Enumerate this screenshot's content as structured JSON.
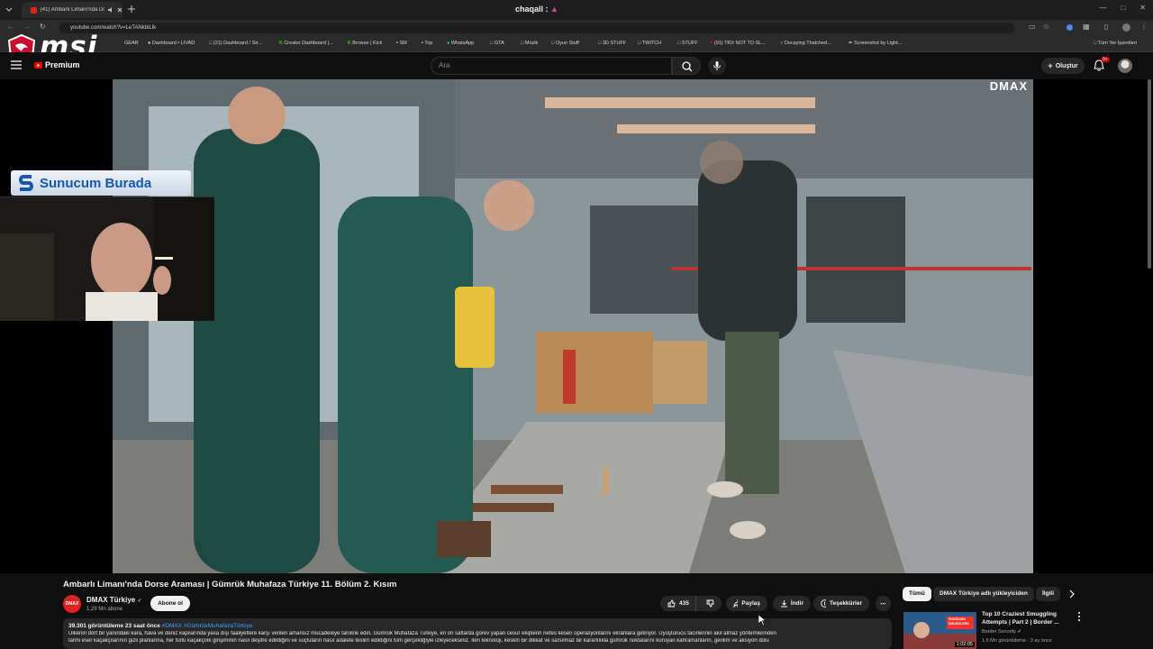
{
  "browser": {
    "tab_title": "(41) Ambarlı Limanı'nda Dorse",
    "center_title": "chaqall :",
    "url": "youtube.com/watch?v=LeTANkbiLlk",
    "bookmarks": [
      "GEAR",
      "Dashboard • LIVAD",
      "(21) Dashboard / Str...",
      "Creator Dashboard |...",
      "Browse | Kick",
      "SM",
      "Top",
      "WhatsApp",
      "GTA",
      "Müzik",
      "Oyun Stuff",
      "3D STUFF",
      "TWITCH",
      "STUFF",
      "(91) TRX NOT TO SL...",
      "Decaying Thatched...",
      "Screenshot by Light...",
      "Tüm Yer İşaretleri"
    ]
  },
  "overlay": {
    "logo_text": "msi",
    "sunucum_label": "Sunucum Burada"
  },
  "youtube": {
    "premium_label": "Premium",
    "search_placeholder": "Ara",
    "create_label": "Oluştur",
    "notif_count": "9+",
    "watermark": "DMAX"
  },
  "video": {
    "title": "Ambarlı Limanı'nda Dorse Araması | Gümrük Muhafaza Türkiye 11. Bölüm 2. Kısım",
    "channel_name": "DMAX Türkiye",
    "channel_avatar": "DMAX",
    "subscribers": "1,29 Mn abone",
    "subscribe_label": "Abone ol",
    "likes": "435",
    "share_label": "Paylaş",
    "download_label": "İndir",
    "thanks_label": "Teşekkürler",
    "views_time": "39.301 görüntüleme  23 saat önce",
    "tags": "#DMAX #GümrükMuhafazaTürkiye",
    "desc_line1": "Ülkenin dört bir yanındaki kara, hava ve deniz kapılarında yasa dışı faaliyetlere karşı verilen amansız mücadeleye tanıklık edin. Gümrük Muhafaza Türkiye, en ön saflarda görev yapan cesur ekiplerin nefes kesen operasyonlarını ekranlara getiriyor. Uyuşturucu tacirlerinin akıl almaz yöntemlerinden",
    "desc_line2": "tarihi eser kaçakçılarının gizli planlarına, her türlü kaçakçılık girişiminin nasıl deşifre edildiğini ve suçluların nasıl adalete teslim edildiğini tüm gerçekliğiyle izleyeceksiniz. İleri teknoloji, keskin bir dikkat ve sarsılmaz bir kararlılıkla gümrük noktalarını koruyan kahramanların, gerilim ve aksiyon dolu"
  },
  "sidebar": {
    "chips": [
      "Tümü",
      "DMAX Türkiye adlı yükleyiciden",
      "İlgili"
    ],
    "rec": {
      "title": "Top 10 Craziest Smuggling Attempts | Part 2 | Border ...",
      "channel": "Border Security",
      "meta": "1,5 Mn görüntüleme · 3 ay önce",
      "duration": "1:02:05",
      "thumb_text": "SHOCKING SMUGGLERS"
    }
  },
  "colors": {
    "background": "#0f0f0f",
    "accent_red": "#ff0000",
    "chip_bg": "#272727",
    "link_blue": "#3ea6ff"
  }
}
